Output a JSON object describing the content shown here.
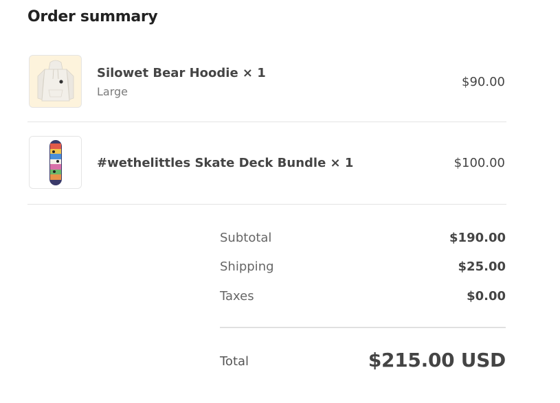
{
  "order_summary": {
    "title": "Order summary",
    "items": [
      {
        "name": "Silowet Bear Hoodie × 1",
        "variant": "Large",
        "price": "$90.00",
        "image": "hoodie-image"
      },
      {
        "name": "#wethelittles Skate Deck Bundle × 1",
        "variant": "",
        "price": "$100.00",
        "image": "skate-deck-image"
      }
    ],
    "totals": {
      "subtotal_label": "Subtotal",
      "subtotal_value": "$190.00",
      "shipping_label": "Shipping",
      "shipping_value": "$25.00",
      "taxes_label": "Taxes",
      "taxes_value": "$0.00",
      "total_label": "Total",
      "total_value": "$215.00 USD"
    }
  },
  "colors": {
    "text_primary": "#444444",
    "text_secondary": "#7a7a7a",
    "divider": "#e3e3e3",
    "hoodie_bg": "#fdf3dc"
  }
}
